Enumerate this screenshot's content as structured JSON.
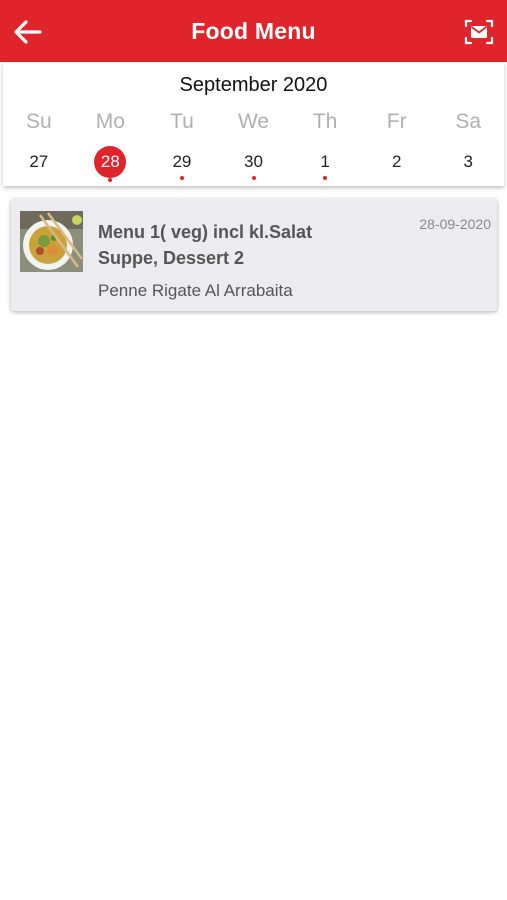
{
  "appbar": {
    "title": "Food Menu",
    "back_icon": "arrow-left-icon",
    "mail_icon": "mail-scan-icon",
    "color": "#e0242b"
  },
  "calendar": {
    "month": "September 2020",
    "days": [
      "Su",
      "Mo",
      "Tu",
      "We",
      "Th",
      "Fr",
      "Sa"
    ],
    "dates": [
      {
        "label": "27",
        "selected": false,
        "has_event": false
      },
      {
        "label": "28",
        "selected": true,
        "has_event": true
      },
      {
        "label": "29",
        "selected": false,
        "has_event": true
      },
      {
        "label": "30",
        "selected": false,
        "has_event": true
      },
      {
        "label": "1",
        "selected": false,
        "has_event": true
      },
      {
        "label": "2",
        "selected": false,
        "has_event": false
      },
      {
        "label": "3",
        "selected": false,
        "has_event": false
      }
    ]
  },
  "menu_items": [
    {
      "title": "Menu 1( veg) incl kl.Salat Suppe, Dessert 2",
      "date": "28-09-2020",
      "subtitle": "Penne Rigate Al Arrabaita",
      "image_icon": "soup-bowl-image"
    }
  ]
}
